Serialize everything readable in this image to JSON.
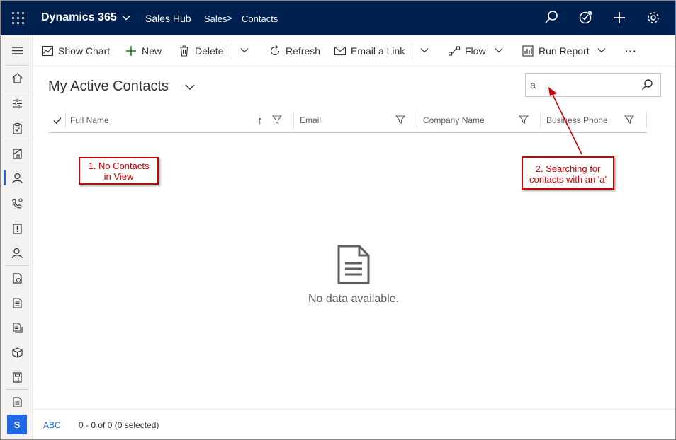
{
  "topbar": {
    "brand": "Dynamics 365",
    "app": "Sales Hub",
    "breadcrumb": [
      "Sales",
      "Contacts"
    ],
    "breadcrumb_sep": ">"
  },
  "commands": {
    "show_chart": "Show Chart",
    "new": "New",
    "delete": "Delete",
    "refresh": "Refresh",
    "email_link": "Email a Link",
    "flow": "Flow",
    "run_report": "Run Report",
    "more": "···"
  },
  "view": {
    "title": "My Active Contacts"
  },
  "search": {
    "value": "a"
  },
  "grid": {
    "columns": [
      "Full Name",
      "Email",
      "Company Name",
      "Business Phone"
    ],
    "sort_glyph": "↑",
    "empty_text": "No data available."
  },
  "annotations": {
    "note1_line1": "1. No Contacts",
    "note1_line2": "in View",
    "note2_line1": "2. Searching for",
    "note2_line2": "contacts with an 'a'",
    "color": "#d00000"
  },
  "footer": {
    "abc": "ABC",
    "record_count": "0 - 0 of 0 (0 selected)"
  },
  "user": {
    "initial": "S"
  },
  "colors": {
    "topbar": "#002050",
    "accent": "#2266e3"
  }
}
